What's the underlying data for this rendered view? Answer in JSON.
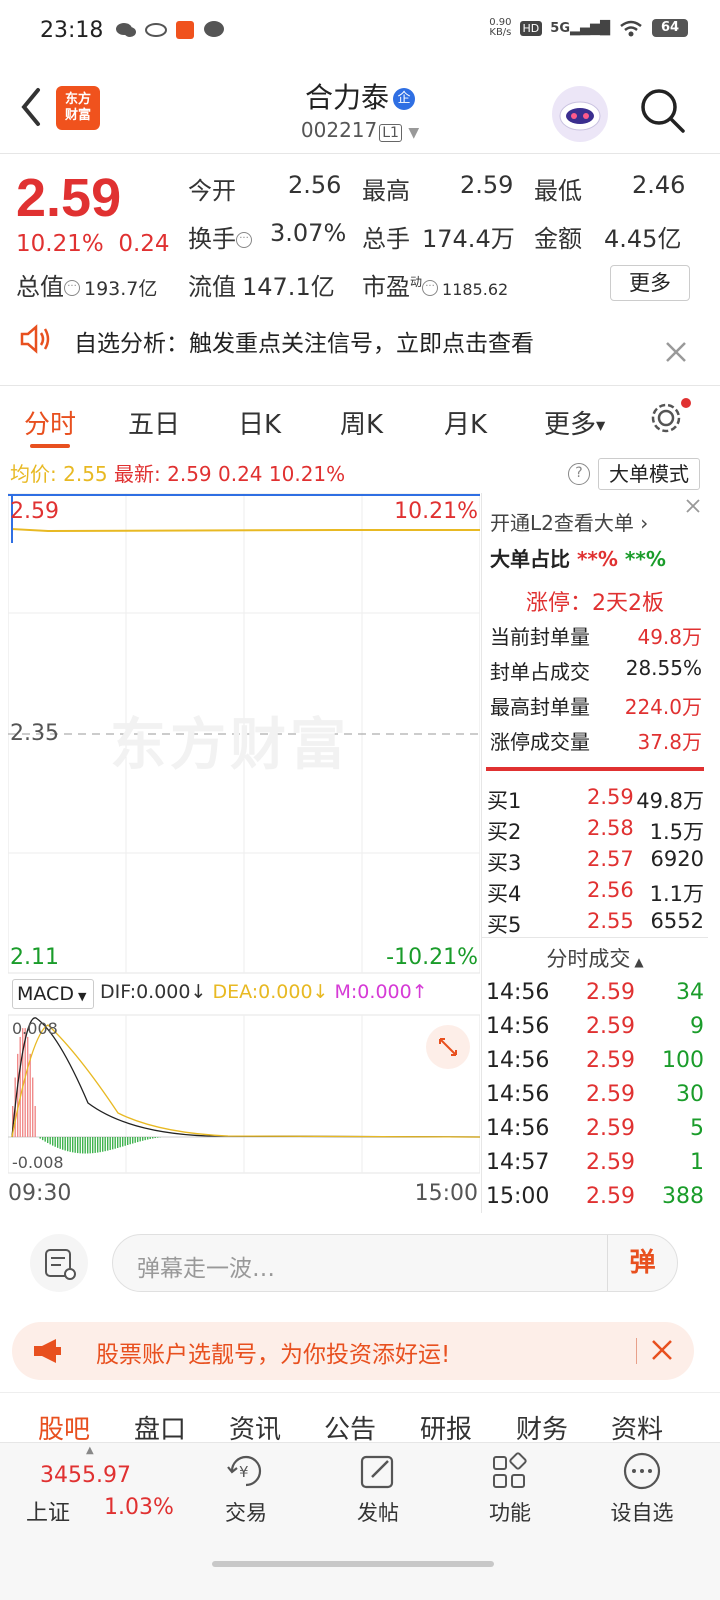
{
  "status": {
    "time": "23:18",
    "net_speed_value": "0.90",
    "net_speed_unit": "KB/s",
    "hd": "HD",
    "signal": "5G",
    "battery": "64"
  },
  "header": {
    "logo_line1": "东方",
    "logo_line2": "财富",
    "title": "合力泰",
    "badge": "企",
    "code": "002217",
    "level": "L1"
  },
  "quote": {
    "price": "2.59",
    "change_pct": "10.21%",
    "change": "0.24",
    "open_label": "今开",
    "open": "2.56",
    "high_label": "最高",
    "high": "2.59",
    "low_label": "最低",
    "low": "2.46",
    "turnover_label": "换手",
    "turnover": "3.07%",
    "volume_label": "总手",
    "volume": "174.4万",
    "amount_label": "金额",
    "amount": "4.45亿",
    "mktcap_label": "总值",
    "mktcap": "193.7亿",
    "float_label": "流值",
    "float_cap": "147.1亿",
    "pe_label": "市盈",
    "pe_sup": "动",
    "pe": "1185.62",
    "more": "更多"
  },
  "notice": {
    "text": "自选分析：触发重点关注信号，立即点击查看"
  },
  "tabs": [
    "分时",
    "五日",
    "日K",
    "周K",
    "月K",
    "更多"
  ],
  "chart_info": {
    "avg_label": "均价:",
    "avg": "2.55",
    "latest_label": "最新:",
    "latest": "2.59",
    "chg": "0.24",
    "pct": "10.21%",
    "big_mode": "大单模式",
    "help": "?"
  },
  "chart_labels": {
    "top_price": "2.59",
    "top_pct": "10.21%",
    "mid_price": "2.35",
    "bottom_price": "2.11",
    "bottom_pct": "-10.21%",
    "watermark": "东方财富",
    "macd_select": "MACD",
    "dif": "DIF:0.000",
    "dea": "DEA:0.000",
    "m": "M:0.000",
    "macd_top": "0.008",
    "macd_bottom": "-0.008",
    "time_start": "09:30",
    "time_end": "15:00"
  },
  "chart_data": {
    "type": "line",
    "x": [
      "09:30",
      "15:00"
    ],
    "series": [],
    "ylim": [
      2.11,
      2.59
    ],
    "reference": 2.35
  },
  "right_panel": {
    "l2_link": "开通L2查看大单",
    "big_ratio_label": "大单占比",
    "big_ratio_buy": "**%",
    "big_ratio_sell": "**%",
    "limit_status": "涨停：2天2板",
    "rows": [
      {
        "label": "当前封单量",
        "value": "49.8万"
      },
      {
        "label": "封单占成交",
        "value": "28.55%"
      },
      {
        "label": "最高封单量",
        "value": "224.0万"
      },
      {
        "label": "涨停成交量",
        "value": "37.8万"
      }
    ],
    "book": [
      {
        "label": "买1",
        "price": "2.59",
        "qty": "49.8万"
      },
      {
        "label": "买2",
        "price": "2.58",
        "qty": "1.5万"
      },
      {
        "label": "买3",
        "price": "2.57",
        "qty": "6920"
      },
      {
        "label": "买4",
        "price": "2.56",
        "qty": "1.1万"
      },
      {
        "label": "买5",
        "price": "2.55",
        "qty": "6552"
      }
    ],
    "ticks_title": "分时成交",
    "ticks": [
      {
        "time": "14:56",
        "price": "2.59",
        "qty": "34"
      },
      {
        "time": "14:56",
        "price": "2.59",
        "qty": "9"
      },
      {
        "time": "14:56",
        "price": "2.59",
        "qty": "100"
      },
      {
        "time": "14:56",
        "price": "2.59",
        "qty": "30"
      },
      {
        "time": "14:56",
        "price": "2.59",
        "qty": "5"
      },
      {
        "time": "14:57",
        "price": "2.59",
        "qty": "1"
      },
      {
        "time": "15:00",
        "price": "2.59",
        "qty": "388"
      }
    ]
  },
  "danmu": {
    "placeholder": "弹幕走一波…",
    "send": "弹"
  },
  "promo": {
    "text": "股票账户选靓号，为你投资添好运!"
  },
  "bottom_tabs": [
    "股吧",
    "盘口",
    "资讯",
    "公告",
    "研报",
    "财务",
    "资料"
  ],
  "footer": {
    "index_value": "3455.97",
    "index_name": "上证",
    "index_pct": "1.03%",
    "buttons": [
      "交易",
      "发帖",
      "功能",
      "设自选"
    ]
  },
  "colors": {
    "up": "#e03131",
    "down": "#1a9c2a",
    "accent": "#e8501f",
    "price_line": "#2f6fe3",
    "avg_line": "#e8b923"
  }
}
